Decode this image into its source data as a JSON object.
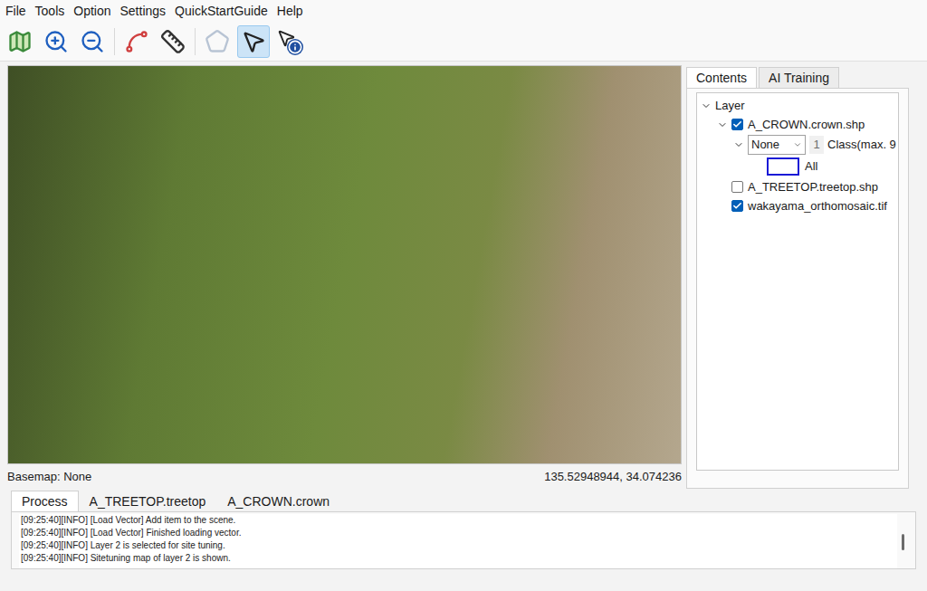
{
  "menu": [
    "File",
    "Tools",
    "Option",
    "Settings",
    "QuickStartGuide",
    "Help"
  ],
  "toolbar": [
    {
      "tool": "map",
      "selected": false,
      "disabled": false
    },
    {
      "tool": "zoom-in",
      "selected": false,
      "disabled": false
    },
    {
      "tool": "zoom-out",
      "selected": false,
      "disabled": false
    },
    {
      "tool": "polyline",
      "selected": false,
      "disabled": false
    },
    {
      "tool": "ruler",
      "selected": false,
      "disabled": false
    },
    {
      "tool": "polygon",
      "selected": false,
      "disabled": true
    },
    {
      "tool": "pointer",
      "selected": true,
      "disabled": false
    },
    {
      "tool": "info",
      "selected": false,
      "disabled": false
    }
  ],
  "map": {
    "basemap": "Basemap: None",
    "coordinates": "135.52948944, 34.074236"
  },
  "panel_tabs": [
    {
      "label": "Contents",
      "selected": true
    },
    {
      "label": "AI Training",
      "selected": false
    }
  ],
  "layers": {
    "root": {
      "label": "Layer",
      "expanded": true
    },
    "items": [
      {
        "label": "A_CROWN.crown.shp",
        "checked": true,
        "expanded": true,
        "class_select": "None",
        "class_count": "1",
        "class_label": "Class(max. 9",
        "classes": [
          {
            "label": "All",
            "color": "#1a1ad6"
          }
        ]
      },
      {
        "label": "A_TREETOP.treetop.shp",
        "checked": false,
        "expanded": false,
        "classes": []
      },
      {
        "label": "wakayama_orthomosaic.tif",
        "checked": true,
        "expanded": false,
        "classes": []
      }
    ]
  },
  "bottom_tabs": [
    {
      "label": "Process",
      "selected": true
    },
    {
      "label": "A_TREETOP.treetop",
      "selected": false
    },
    {
      "label": "A_CROWN.crown",
      "selected": false
    }
  ],
  "log": [
    "[09:25:40][INFO] [Load Vector] Add item to the scene.",
    "[09:25:40][INFO] [Load Vector] Finished loading vector.",
    "[09:25:40][INFO] Layer 2 is selected for site tuning.",
    "[09:25:40][INFO] Sitetuning map of layer 2 is shown."
  ]
}
